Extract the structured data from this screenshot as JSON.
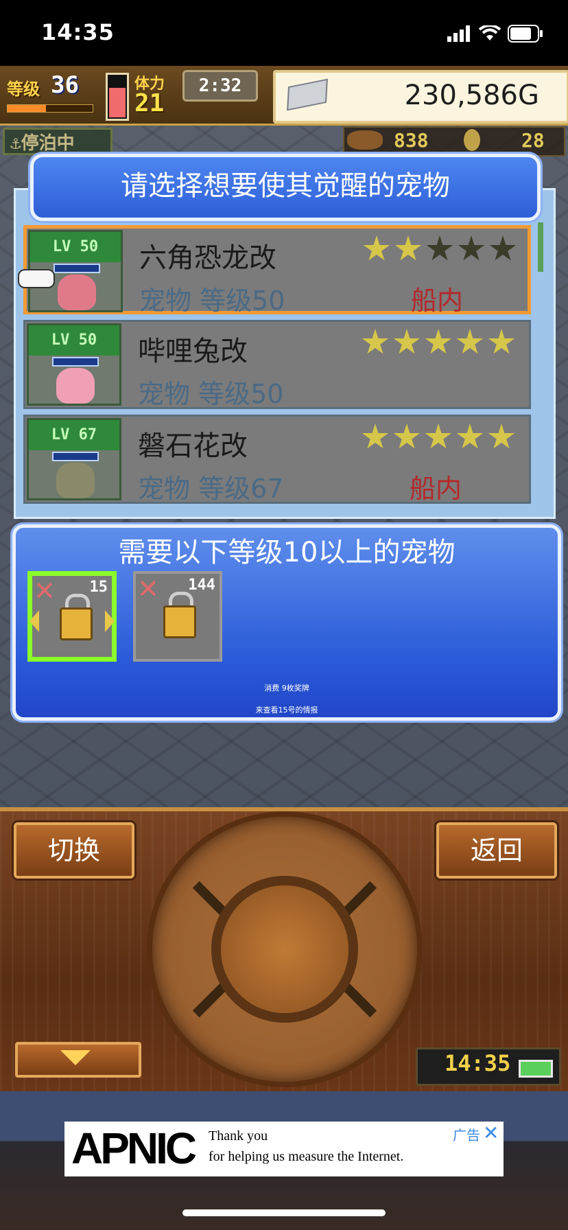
{
  "status_bar": {
    "time": "14:35"
  },
  "hud": {
    "level_label": "等级",
    "level": "36",
    "level_progress": 0.45,
    "stamina_level": 0.75,
    "stamina_label": "体力",
    "stamina": "21",
    "clock": "2:32",
    "money": "230,586G",
    "dock_label": "停泊中",
    "resource_a": "838",
    "resource_b": "28"
  },
  "dialog": {
    "title": "请选择想要使其觉醒的宠物",
    "pets": [
      {
        "level_badge": "LV 50",
        "name": "六角恐龙改",
        "desc": "宠物 等级50",
        "location": "船内",
        "stars_on": 2,
        "stars_total": 5,
        "selected": true
      },
      {
        "level_badge": "LV 50",
        "name": "哔哩兔改",
        "desc": "宠物 等级50",
        "location": "",
        "stars_on": 5,
        "stars_total": 5,
        "selected": false
      },
      {
        "level_badge": "LV 67",
        "name": "磐石花改",
        "desc": "宠物 等级67",
        "location": "船内",
        "stars_on": 5,
        "stars_total": 5,
        "selected": false
      }
    ]
  },
  "requirement": {
    "title": "需要以下等级10以上的宠物",
    "slots": [
      {
        "number": "15",
        "selected": true
      },
      {
        "number": "144",
        "selected": false
      }
    ],
    "note1": "消费 9枚奖牌",
    "note2": "来查看15号的情报"
  },
  "controls": {
    "switch_label": "切换",
    "back_label": "返回",
    "clock": "14:35"
  },
  "ad": {
    "logo": "APNIC",
    "line1": "Thank you",
    "line2": "for helping us measure the Internet.",
    "label": "广告"
  },
  "colors": {
    "star_on": "#d6c64a",
    "location_red": "#b4282a",
    "selected_border": "#f39a34",
    "panel_blue": "#2a5ad8"
  }
}
